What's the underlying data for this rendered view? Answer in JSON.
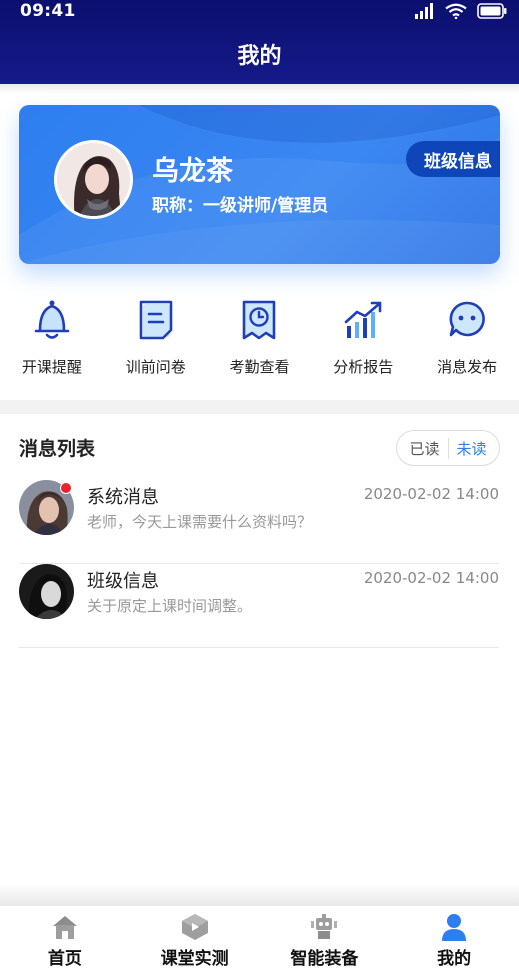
{
  "status": {
    "time": "09:41"
  },
  "header": {
    "title": "我的"
  },
  "profile": {
    "name": "乌龙茶",
    "role": "职称：一级讲师/管理员",
    "class_info_label": "班级信息"
  },
  "actions": [
    {
      "label": "开课提醒",
      "icon": "bell-icon"
    },
    {
      "label": "训前问卷",
      "icon": "questionnaire-icon"
    },
    {
      "label": "考勤查看",
      "icon": "attendance-clock-icon"
    },
    {
      "label": "分析报告",
      "icon": "bar-chart-icon"
    },
    {
      "label": "消息发布",
      "icon": "chat-bubble-icon"
    }
  ],
  "messages": {
    "title": "消息列表",
    "toggle": {
      "read": "已读",
      "unread": "未读",
      "active": "unread"
    },
    "items": [
      {
        "name": "系统消息",
        "time": "2020-02-02  14:00",
        "preview": "老师，今天上课需要什么资料吗？",
        "unread": true
      },
      {
        "name": "班级信息",
        "time": "2020-02-02  14:00",
        "preview": "关于原定上课时间调整。",
        "unread": false
      }
    ]
  },
  "tabs": [
    {
      "label": "首页",
      "icon": "home-icon"
    },
    {
      "label": "课堂实测",
      "icon": "class-test-icon"
    },
    {
      "label": "智能装备",
      "icon": "robot-icon"
    },
    {
      "label": "我的",
      "icon": "user-icon",
      "active": true
    }
  ],
  "colors": {
    "header_bg": "#0b0f6e",
    "card_blue": "#2d7ef0",
    "accent_blue": "#2d7ef0",
    "icon_blue": "#1f3fb8",
    "unread_dot": "#e8242b"
  }
}
